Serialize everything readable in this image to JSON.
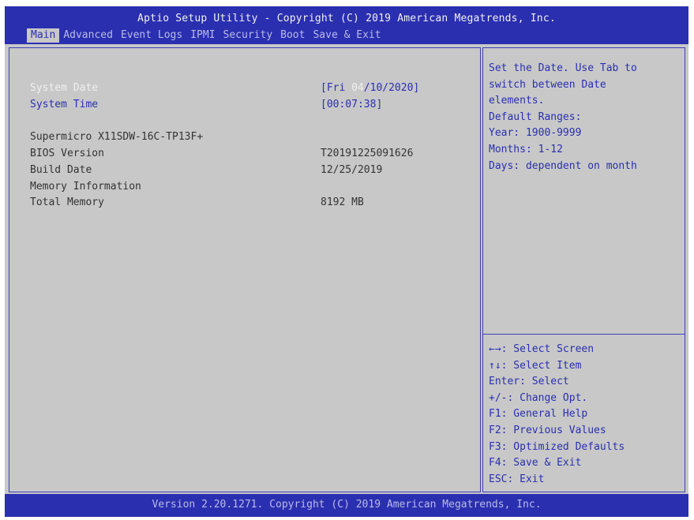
{
  "header": {
    "title": "Aptio Setup Utility - Copyright (C) 2019 American Megatrends, Inc.",
    "tabs": [
      {
        "label": "Main",
        "active": true
      },
      {
        "label": "Advanced"
      },
      {
        "label": "Event Logs"
      },
      {
        "label": "IPMI"
      },
      {
        "label": "Security"
      },
      {
        "label": "Boot"
      },
      {
        "label": "Save & Exit"
      }
    ]
  },
  "main": {
    "system_date": {
      "label": "System Date",
      "value_prefix": "[Fri ",
      "value_highlight": "04",
      "value_suffix": "/10/2020]"
    },
    "system_time": {
      "label": "System Time",
      "value": "[00:07:38]"
    },
    "board": {
      "label": "Supermicro X11SDW-16C-TP13F+"
    },
    "bios_version": {
      "label": "BIOS Version",
      "value": "T20191225091626"
    },
    "build_date": {
      "label": "Build Date",
      "value": "12/25/2019"
    },
    "memory_info": {
      "label": "Memory Information"
    },
    "total_memory": {
      "label": "Total Memory",
      "value": "8192 MB"
    }
  },
  "help": {
    "lines": [
      "Set the Date. Use Tab to",
      "switch between Date",
      "elements.",
      "Default Ranges:",
      "Year: 1900-9999",
      "Months: 1-12",
      "Days: dependent on month"
    ]
  },
  "keys": {
    "lines": [
      "←→: Select Screen",
      "↑↓: Select Item",
      "Enter: Select",
      "+/-: Change Opt.",
      "F1: General Help",
      "F2: Previous Values",
      "F3: Optimized Defaults",
      "F4: Save & Exit",
      "ESC: Exit"
    ]
  },
  "footer": {
    "text": "Version 2.20.1271. Copyright (C) 2019 American Megatrends, Inc."
  },
  "colors": {
    "bar_blue": "#2a2fb0",
    "panel_gray": "#c8c8c8",
    "text_blue": "#2a2fb0",
    "highlight_white": "#f0f0f0"
  }
}
